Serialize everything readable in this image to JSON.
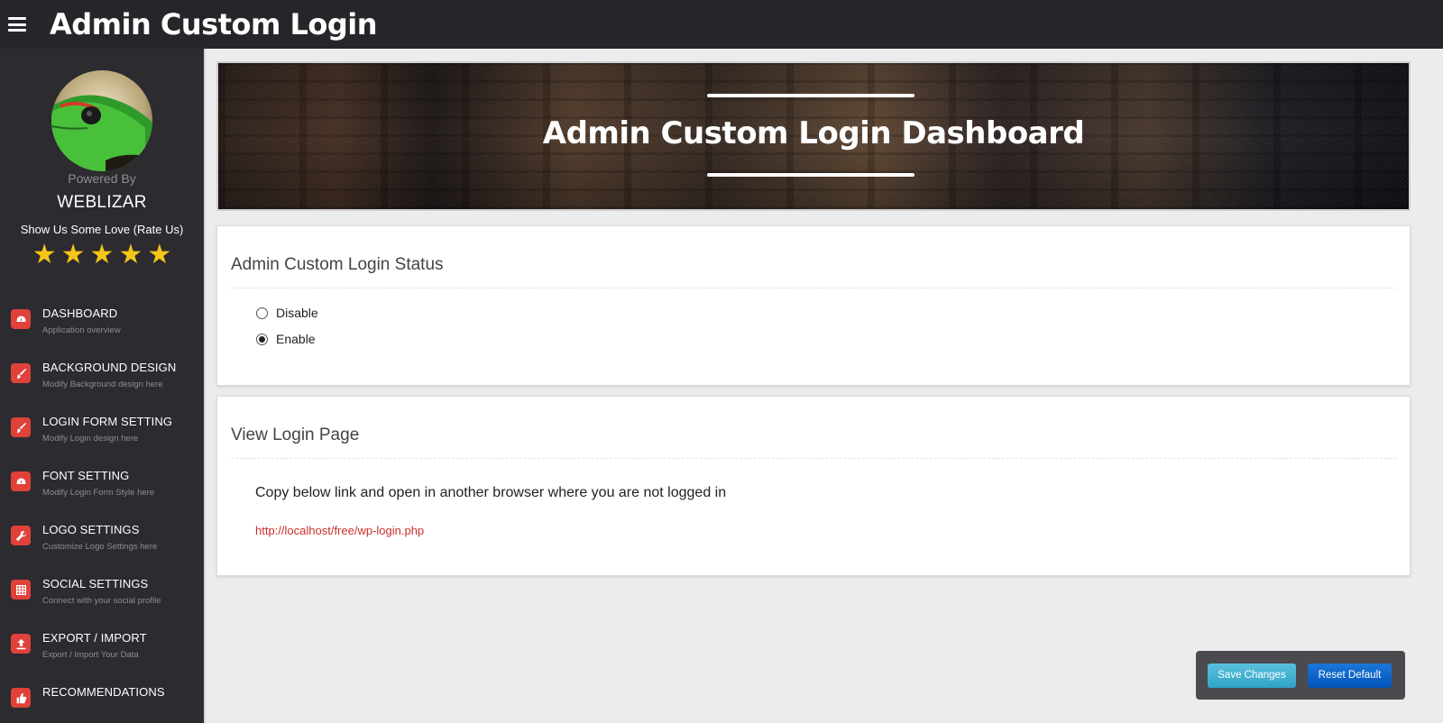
{
  "header": {
    "title": "Admin Custom Login"
  },
  "sidebar": {
    "powered_by": "Powered By",
    "brand": "WEBLIZAR",
    "rate_text": "Show Us Some Love (Rate Us)",
    "rating": 5,
    "items": [
      {
        "label": "DASHBOARD",
        "sub": "Application overview",
        "icon": "dashboard-icon"
      },
      {
        "label": "BACKGROUND DESIGN",
        "sub": "Modify Background design here",
        "icon": "brush-icon"
      },
      {
        "label": "LOGIN FORM SETTING",
        "sub": "Modify Login design here",
        "icon": "brush-icon"
      },
      {
        "label": "FONT SETTING",
        "sub": "Modify Login Form Style here",
        "icon": "dashboard-icon"
      },
      {
        "label": "LOGO SETTINGS",
        "sub": "Customize Logo Settings here",
        "icon": "wrench-icon"
      },
      {
        "label": "SOCIAL SETTINGS",
        "sub": "Connect with your social profile",
        "icon": "grid-icon"
      },
      {
        "label": "EXPORT / IMPORT",
        "sub": "Export / Import Your Data",
        "icon": "upload-icon"
      },
      {
        "label": "RECOMMENDATIONS",
        "sub": "",
        "icon": "thumbs-up-icon"
      }
    ]
  },
  "banner": {
    "title": "Admin Custom Login Dashboard"
  },
  "status_panel": {
    "title": "Admin Custom Login Status",
    "options": [
      "Disable",
      "Enable"
    ],
    "selected": "Enable"
  },
  "view_panel": {
    "title": "View Login Page",
    "instruction": "Copy below link and open in another browser where you are not logged in",
    "link": "http://localhost/free/wp-login.php"
  },
  "actions": {
    "save_label": "Save Changes",
    "reset_label": "Reset Default"
  },
  "colors": {
    "accent": "#e0413a",
    "save": "#5bc0de",
    "reset": "#0a63c9",
    "link": "#c9302c"
  }
}
